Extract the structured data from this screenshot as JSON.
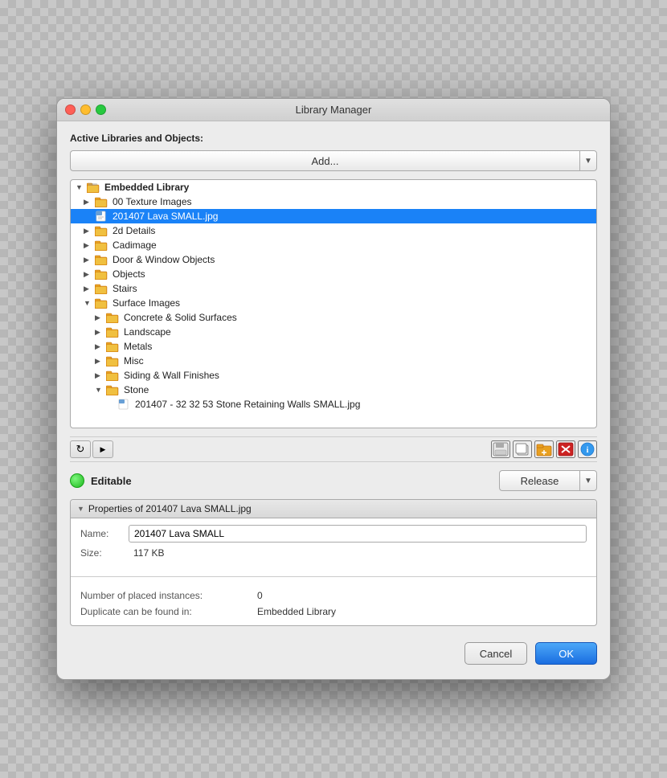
{
  "titlebar": {
    "title": "Library Manager"
  },
  "dialog": {
    "active_libraries_label": "Active Libraries and Objects:",
    "add_button_label": "Add..."
  },
  "tree": {
    "items": [
      {
        "id": "embedded-library",
        "label": "Embedded Library",
        "type": "root",
        "indent": 0,
        "expanded": true,
        "arrow": "▼"
      },
      {
        "id": "texture-images",
        "label": "00 Texture Images",
        "type": "folder",
        "indent": 1,
        "expanded": false,
        "arrow": "▶"
      },
      {
        "id": "lava-file",
        "label": "201407 Lava SMALL.jpg",
        "type": "file",
        "indent": 1,
        "selected": true
      },
      {
        "id": "2d-details",
        "label": "2d Details",
        "type": "folder",
        "indent": 1,
        "expanded": false,
        "arrow": "▶"
      },
      {
        "id": "cadimage",
        "label": "Cadimage",
        "type": "folder",
        "indent": 1,
        "expanded": false,
        "arrow": "▶"
      },
      {
        "id": "door-window",
        "label": "Door & Window Objects",
        "type": "folder",
        "indent": 1,
        "expanded": false,
        "arrow": "▶"
      },
      {
        "id": "objects",
        "label": "Objects",
        "type": "folder",
        "indent": 1,
        "expanded": false,
        "arrow": "▶"
      },
      {
        "id": "stairs",
        "label": "Stairs",
        "type": "folder",
        "indent": 1,
        "expanded": false,
        "arrow": "▶"
      },
      {
        "id": "surface-images",
        "label": "Surface Images",
        "type": "folder",
        "indent": 1,
        "expanded": true,
        "arrow": "▼"
      },
      {
        "id": "concrete",
        "label": "Concrete & Solid Surfaces",
        "type": "folder",
        "indent": 2,
        "expanded": false,
        "arrow": "▶"
      },
      {
        "id": "landscape",
        "label": "Landscape",
        "type": "folder",
        "indent": 2,
        "expanded": false,
        "arrow": "▶"
      },
      {
        "id": "metals",
        "label": "Metals",
        "type": "folder",
        "indent": 2,
        "expanded": false,
        "arrow": "▶"
      },
      {
        "id": "misc",
        "label": "Misc",
        "type": "folder",
        "indent": 2,
        "expanded": false,
        "arrow": "▶"
      },
      {
        "id": "siding",
        "label": "Siding & Wall Finishes",
        "type": "folder",
        "indent": 2,
        "expanded": false,
        "arrow": "▶"
      },
      {
        "id": "stone",
        "label": "Stone",
        "type": "folder",
        "indent": 2,
        "expanded": true,
        "arrow": "▼"
      },
      {
        "id": "stone-file",
        "label": "201407 - 32 32 53 Stone Retaining Walls SMALL.jpg",
        "type": "file",
        "indent": 3
      }
    ]
  },
  "toolbar": {
    "refresh_label": "↻",
    "arrow_label": "▶",
    "save_icon": "💾",
    "copy_icon": "📋",
    "folder_icon": "📁",
    "delete_icon": "✕",
    "info_icon": "ℹ"
  },
  "status": {
    "editable_label": "Editable",
    "release_label": "Release"
  },
  "properties": {
    "header_label": "Properties of 201407 Lava SMALL.jpg",
    "name_label": "Name:",
    "name_value": "201407 Lava SMALL",
    "size_label": "Size:",
    "size_value": "117 KB"
  },
  "stats": {
    "instances_label": "Number of placed instances:",
    "instances_value": "0",
    "duplicate_label": "Duplicate can be found in:",
    "duplicate_value": "Embedded Library"
  },
  "buttons": {
    "cancel_label": "Cancel",
    "ok_label": "OK"
  }
}
